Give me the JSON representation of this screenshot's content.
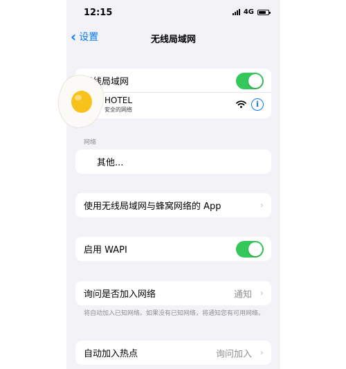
{
  "status_bar": {
    "time": "12:15",
    "network": "4G"
  },
  "nav": {
    "back_label": "设置",
    "title": "无线局域网"
  },
  "wifi_section": {
    "toggle_label": "无线局域网",
    "toggle_on": true,
    "network_name": "HOTEL",
    "network_subtitle": "安全的网络"
  },
  "networks_section": {
    "header": "网络",
    "other_label": "其他..."
  },
  "apps_row": {
    "label": "使用无线局域网与蜂窝网络的 App"
  },
  "wapi_row": {
    "label": "启用 WAPI",
    "toggle_on": true
  },
  "ask_join": {
    "label": "询问是否加入网络",
    "value": "通知",
    "note": "将自动加入已知网络。如果没有已知网络，将通知您有可用网络。"
  },
  "hotspot": {
    "label": "自动加入热点",
    "value": "询问加入"
  },
  "colors": {
    "accent": "#0a7aff",
    "toggle_on": "#34c759",
    "background": "#f2f2f7"
  },
  "icons": [
    "chevron-left-icon",
    "cellular-signal-icon",
    "battery-icon",
    "wifi-icon",
    "info-icon",
    "chevron-right-icon",
    "fried-egg-sticker"
  ]
}
